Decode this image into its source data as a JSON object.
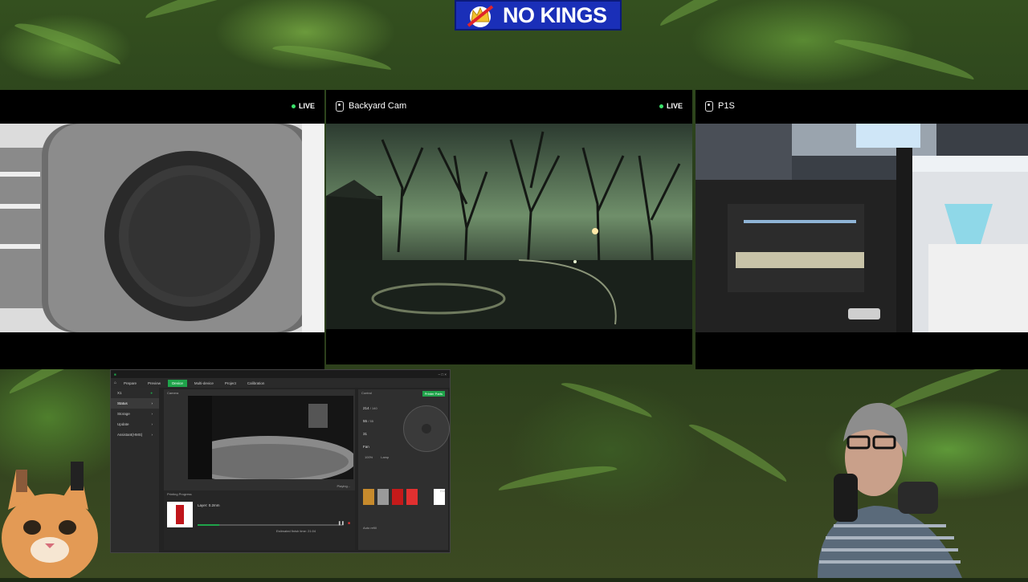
{
  "banner": {
    "text": "NO KINGS"
  },
  "cameras": [
    {
      "name": "",
      "live": "LIVE"
    },
    {
      "name": "Backyard Cam",
      "live": "LIVE"
    },
    {
      "name": "P1S",
      "live": ""
    }
  ],
  "app": {
    "title": "",
    "tabs": [
      {
        "label": "Prepare"
      },
      {
        "label": "Preview"
      },
      {
        "label": "Device"
      },
      {
        "label": "Multi-device"
      },
      {
        "label": "Project"
      },
      {
        "label": "Calibration"
      }
    ],
    "device": "X1",
    "sidebar": [
      {
        "label": "Status"
      },
      {
        "label": "Storage"
      },
      {
        "label": "Update"
      },
      {
        "label": "Assistant(HMS)"
      }
    ],
    "camera_label": "Camera",
    "playing": "Playing...",
    "printing_progress": "Printing Progress",
    "job_name": "Layer: 0.2mm",
    "estimated": "Estimated finish time: 21:04",
    "control_label": "Control",
    "printer_parts": "Printer Parts",
    "fan_label": "Fan",
    "lamp_label": "Lamp",
    "temps": [
      {
        "value": "214",
        "target": "/ 140"
      },
      {
        "value": "55",
        "target": "/ 55"
      },
      {
        "value": "31",
        "target": ""
      }
    ],
    "ext_label": "Ext",
    "auto_refill": "Auto refill",
    "progress_percent": 15
  },
  "colors": {
    "accent": "#1fa34a",
    "live_dot": "#3be26b",
    "banner_bg": "#1a2fb8"
  }
}
